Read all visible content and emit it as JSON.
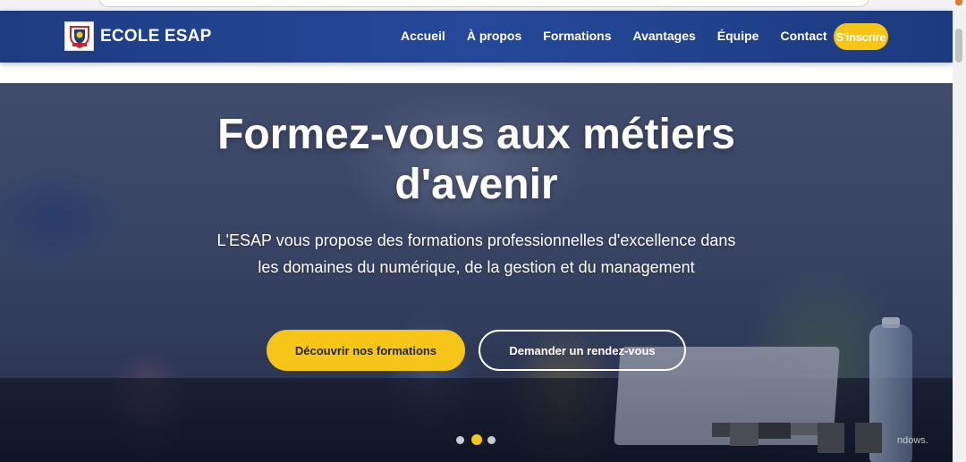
{
  "browser": {
    "url": "/ / / / /"
  },
  "navbar": {
    "brand": "ECOLE ESAP",
    "links": [
      "Accueil",
      "À propos",
      "Formations",
      "Avantages",
      "Équipe",
      "Contact"
    ],
    "cta": "S'inscrire"
  },
  "hero": {
    "title": "Formez-vous aux métiers d'avenir",
    "subtitle": "L'ESAP vous propose des formations professionnelles d'excellence dans les domaines du numérique, de la gestion et du management",
    "primary_button": "Découvrir nos formations",
    "secondary_button": "Demander un rendez-vous",
    "carousel": {
      "slides": 3,
      "active_slide": 2
    }
  },
  "watermark": {
    "text": "ndows."
  },
  "colors": {
    "navbar_blue": "#24468f",
    "accent_yellow": "#f5c518",
    "text_white": "#ffffff"
  }
}
